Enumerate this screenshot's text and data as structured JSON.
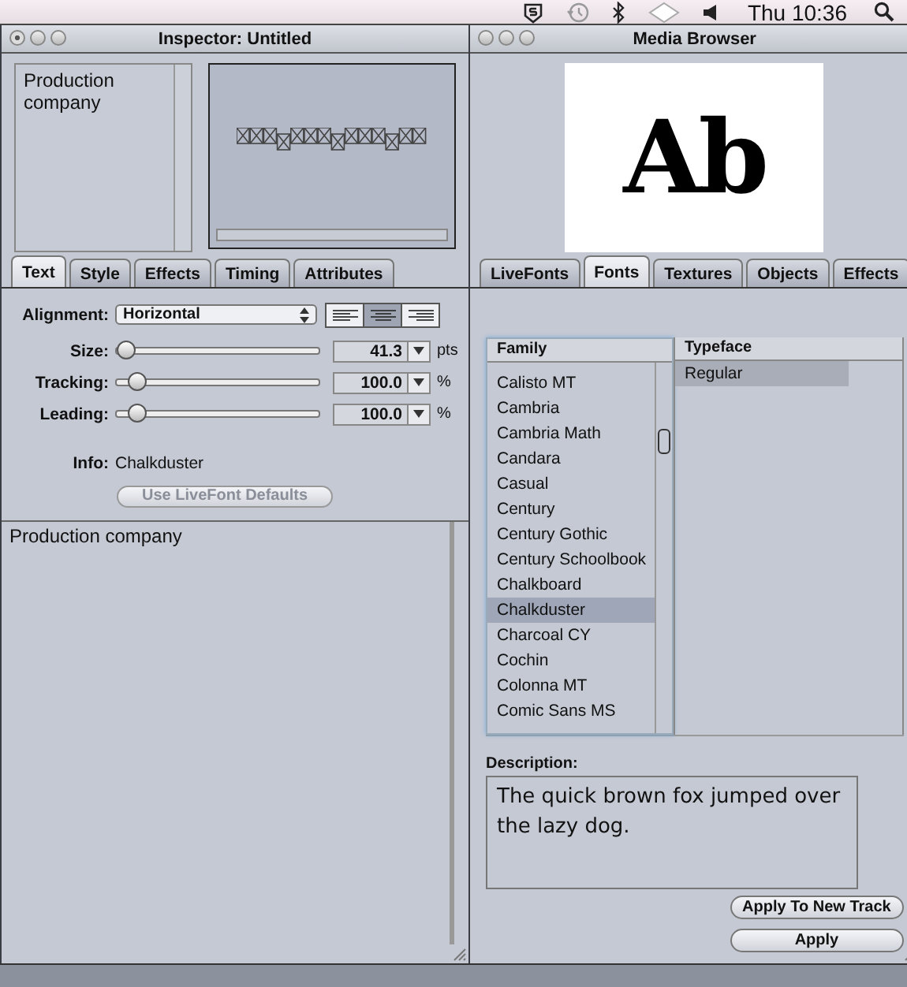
{
  "menu_bar": {
    "clock": "Thu 10:36"
  },
  "inspector": {
    "title": "Inspector: Untitled",
    "layer_list": [
      "Production company"
    ],
    "tabs": [
      {
        "label": "Text",
        "selected": true
      },
      {
        "label": "Style",
        "selected": false
      },
      {
        "label": "Effects",
        "selected": false
      },
      {
        "label": "Timing",
        "selected": false
      },
      {
        "label": "Attributes",
        "selected": false
      }
    ],
    "alignment": {
      "label": "Alignment:",
      "value": "Horizontal",
      "buttons": [
        {
          "kind": "left",
          "selected": false
        },
        {
          "kind": "center",
          "selected": true
        },
        {
          "kind": "right",
          "selected": false
        }
      ]
    },
    "sliders": [
      {
        "label": "Size:",
        "level": 0.05,
        "value": "41.3",
        "unit": "pts"
      },
      {
        "label": "Tracking:",
        "level": 0.1,
        "value": "100.0",
        "unit": "%"
      },
      {
        "label": "Leading:",
        "level": 0.1,
        "value": "100.0",
        "unit": "%"
      }
    ],
    "info": {
      "label": "Info:",
      "value": "Chalkduster"
    },
    "defaults_button": {
      "label": "Use LiveFont Defaults",
      "disabled": true
    },
    "text_content": "Production company"
  },
  "media_browser": {
    "title": "Media Browser",
    "preview_text": "Ab",
    "tabs": [
      {
        "label": "LiveFonts",
        "selected": false
      },
      {
        "label": "Fonts",
        "selected": true
      },
      {
        "label": "Textures",
        "selected": false
      },
      {
        "label": "Objects",
        "selected": false
      },
      {
        "label": "Effects",
        "selected": false
      }
    ],
    "family_header": "Family",
    "typeface_header": "Typeface",
    "families": [
      {
        "name": "Calisto MT",
        "selected": false
      },
      {
        "name": "Cambria",
        "selected": false
      },
      {
        "name": "Cambria Math",
        "selected": false
      },
      {
        "name": "Candara",
        "selected": false
      },
      {
        "name": "Casual",
        "selected": false
      },
      {
        "name": "Century",
        "selected": false
      },
      {
        "name": "Century Gothic",
        "selected": false
      },
      {
        "name": "Century Schoolbook",
        "selected": false
      },
      {
        "name": "Chalkboard",
        "selected": false
      },
      {
        "name": "Chalkduster",
        "selected": true
      },
      {
        "name": "Charcoal CY",
        "selected": false
      },
      {
        "name": "Cochin",
        "selected": false
      },
      {
        "name": "Colonna MT",
        "selected": false
      },
      {
        "name": "Comic Sans MS",
        "selected": false
      }
    ],
    "typefaces": [
      {
        "name": "Regular",
        "selected": true
      }
    ],
    "description_label": "Description:",
    "description": "The quick brown fox jumped over the lazy dog.",
    "buttons": [
      "Apply To New Track",
      "Apply"
    ]
  }
}
